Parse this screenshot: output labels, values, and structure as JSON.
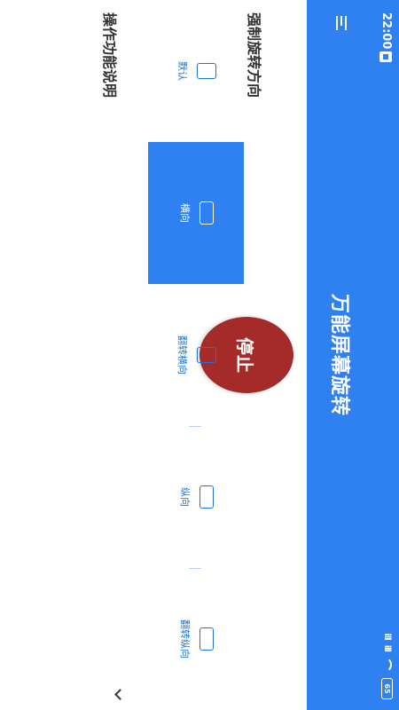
{
  "status": {
    "time": "22:00",
    "signal_left": "ill",
    "signal_right": "ill",
    "battery": "65"
  },
  "appbar": {
    "title": "万能屏幕旋转",
    "menu_icon": "hamburger-menu-icon"
  },
  "main": {
    "stop_label": "停止",
    "orientation_section_title": "强制旋转方向",
    "orientations": [
      {
        "label": "默认",
        "icon": "portrait-phone-icon"
      },
      {
        "label": "横向",
        "icon": "landscape-phone-icon"
      },
      {
        "label": "翻转横向",
        "icon": "portrait-phone-icon"
      },
      {
        "label": "纵向",
        "icon": "landscape-phone-icon"
      },
      {
        "label": "翻转纵向",
        "icon": "landscape-phone-icon"
      }
    ],
    "selected_orientation": "横向",
    "help_section_title": "操作功能说明",
    "expand_icon": "chevron-down-icon"
  }
}
